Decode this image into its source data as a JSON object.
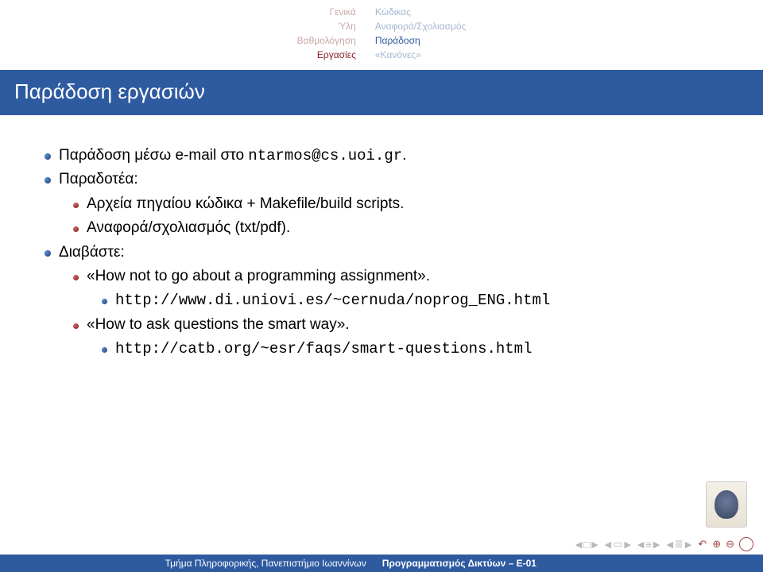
{
  "header": {
    "left": [
      "Γενικά",
      "Ύλη",
      "Βαθμολόγηση",
      "Εργασίες"
    ],
    "right": [
      "Κώδικας",
      "Αναφορά/Σχολιασμός",
      "Παράδοση",
      "«Κανόνες»"
    ]
  },
  "title": "Παράδοση εργασιών",
  "content": {
    "l1": "Παράδοση μέσω e-mail στο ",
    "l1_mono": "ntarmos@cs.uoi.gr",
    "l1_end": ".",
    "l2": "Παραδοτέα:",
    "l2a": "Αρχεία πηγαίου κώδικα + Makefile/build scripts.",
    "l2b": "Αναφορά/σχολιασμός (txt/pdf).",
    "l3": "Διαβάστε:",
    "l3a": "«How not to go about a programming assignment».",
    "l3a_url": "http://www.di.uniovi.es/~cernuda/noprog_ENG.html",
    "l3b": "«How to ask questions the smart way».",
    "l3b_url": "http://catb.org/~esr/faqs/smart-questions.html"
  },
  "footer": {
    "left": "Τμήμα Πληροφορικής, Πανεπιστήμιο Ιωαννίνων",
    "right": "Προγραμματισμός Δικτύων – E-01"
  }
}
